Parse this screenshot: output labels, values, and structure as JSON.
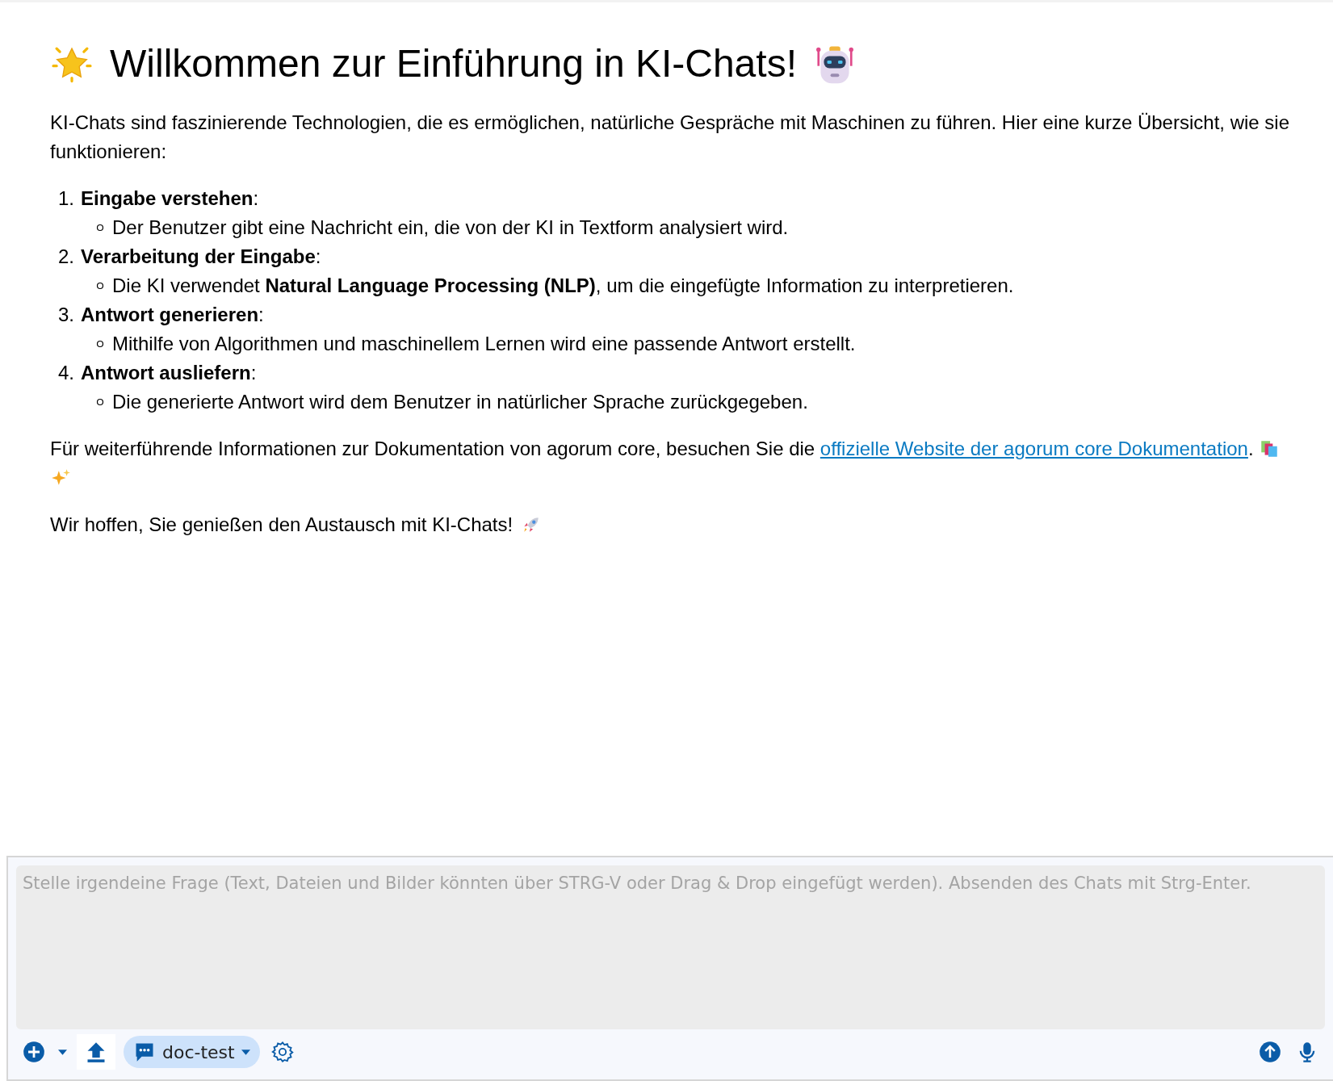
{
  "title": "Willkommen zur Einführung in KI-Chats!",
  "intro": "KI-Chats sind faszinierende Technologien, die es ermöglichen, natürliche Gespräche mit Maschinen zu führen. Hier eine kurze Übersicht, wie sie funktionieren:",
  "steps": [
    {
      "number": "1.",
      "title": "**Eingabe verstehen**:",
      "detail": "Der Benutzer gibt eine Nachricht ein, die von der KI in Textform analysiert wird."
    },
    {
      "number": "2.",
      "title": "**Verarbeitung der Eingabe**:",
      "detail": "Die KI verwendet **Natural Language Processing (NLP)**, um die eingefügte Information zu interpretieren."
    },
    {
      "number": "3.",
      "title": "**Antwort generieren**:",
      "detail": "Mithilfe von Algorithmen und maschinellem Lernen wird eine passende Antwort erstellt."
    },
    {
      "number": "4.",
      "title": "**Antwort ausliefern**:",
      "detail": "Die generierte Antwort wird dem Benutzer in natürlicher Sprache zurückgegeben."
    }
  ],
  "more_info": {
    "before_link": "Für weiterführende Informationen zur Dokumentation von agorum core, besuchen Sie die",
    "link": "offizielle Website der agorum core Dokumentation",
    "after_link": "."
  },
  "closing": "Wir hoffen, Sie genießen den Austausch mit KI-Chats!",
  "composer": {
    "placeholder": "Stelle irgendeine Frage (Text, Dateien und Bilder könnten über STRG-V oder Drag & Drop eingefügt werden). Absenden des Chats mit Strg-Enter.",
    "assistant": "doc-test"
  }
}
